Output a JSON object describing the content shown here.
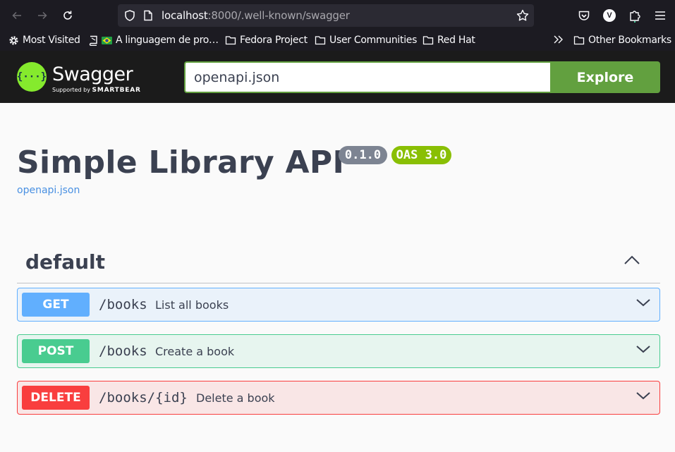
{
  "browser": {
    "url_host": "localhost",
    "url_rest": ":8000/.well-known/swagger",
    "avatar_letter": "V",
    "bookmarks": [
      {
        "label": "Most Visited",
        "icon": "gear-icon"
      },
      {
        "label": "A linguagem de pro…",
        "icon": "book-flag-icon"
      },
      {
        "label": "Fedora Project",
        "icon": "folder-icon"
      },
      {
        "label": "User Communities",
        "icon": "folder-icon"
      },
      {
        "label": "Red Hat",
        "icon": "folder-icon"
      },
      {
        "label": "Other Bookmarks",
        "icon": "folder-icon"
      }
    ]
  },
  "swagger": {
    "logo_word": "Swagger",
    "logo_sub_prefix": "Supported by",
    "logo_sub_brand": "SMARTBEAR",
    "spec_url": "openapi.json",
    "explore_label": "Explore"
  },
  "info": {
    "title": "Simple Library API",
    "version": "0.1.0",
    "oas": "OAS 3.0",
    "spec_link": "openapi.json"
  },
  "tag": {
    "name": "default",
    "operations": [
      {
        "method": "GET",
        "path": "/books",
        "summary": "List all books"
      },
      {
        "method": "POST",
        "path": "/books",
        "summary": "Create a book"
      },
      {
        "method": "DELETE",
        "path": "/books/{id}",
        "summary": "Delete a book"
      }
    ]
  },
  "colors": {
    "get": "#61affe",
    "post": "#49cc90",
    "delete": "#f93e3e",
    "explore": "#62a03f",
    "oas_badge": "#89bf04",
    "version_badge": "#7d8492"
  }
}
